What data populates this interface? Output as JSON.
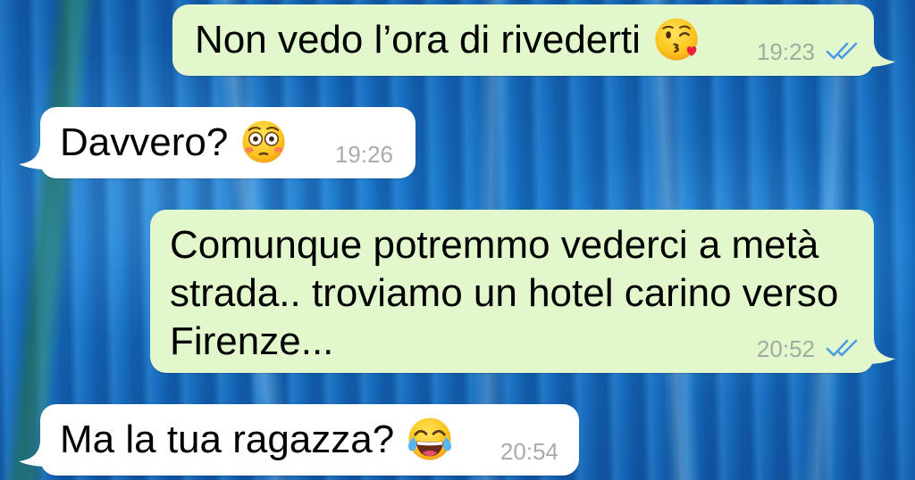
{
  "chat": {
    "messages": [
      {
        "text": "Non vedo l’ora di rivederti",
        "emoji_icon": "face-blowing-a-kiss-icon",
        "time": "19:23",
        "status_icon": "double-check-read-icon"
      },
      {
        "text": "Davvero?",
        "emoji_icon": "flushed-face-icon",
        "time": "19:26"
      },
      {
        "text": "Comunque potremmo vederci a metà strada.. troviamo un hotel carino verso Firenze...",
        "time": "20:52",
        "status_icon": "double-check-read-icon"
      },
      {
        "text": "Ma la tua ragazza?",
        "emoji_icon": "face-with-tears-of-joy-icon",
        "time": "20:54"
      }
    ]
  },
  "colors": {
    "outgoing_bubble": "#e2f7cb",
    "incoming_bubble": "#ffffff",
    "read_check": "#4a9be8",
    "time_text": "#a3ab9f",
    "message_text": "#000000"
  }
}
